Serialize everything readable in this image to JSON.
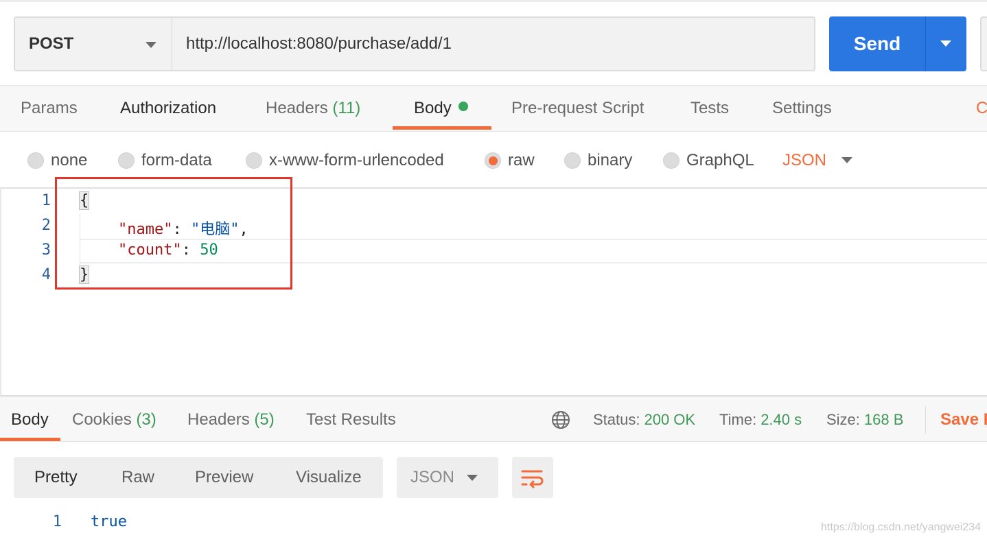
{
  "request": {
    "method": "POST",
    "url": "http://localhost:8080/purchase/add/1",
    "send_label": "Send"
  },
  "request_tabs": [
    {
      "label": "Params",
      "count": ""
    },
    {
      "label": "Authorization",
      "count": ""
    },
    {
      "label": "Headers",
      "count": "(11)"
    },
    {
      "label": "Body",
      "count": ""
    },
    {
      "label": "Pre-request Script",
      "count": ""
    },
    {
      "label": "Tests",
      "count": ""
    },
    {
      "label": "Settings",
      "count": ""
    }
  ],
  "active_request_tab": "Body",
  "cut_off_right_label": "C",
  "body_types": [
    {
      "label": "none",
      "selected": false
    },
    {
      "label": "form-data",
      "selected": false
    },
    {
      "label": "x-www-form-urlencoded",
      "selected": false
    },
    {
      "label": "raw",
      "selected": true
    },
    {
      "label": "binary",
      "selected": false
    },
    {
      "label": "GraphQL",
      "selected": false
    }
  ],
  "body_format": "JSON",
  "editor": {
    "line_numbers": [
      "1",
      "2",
      "3",
      "4"
    ],
    "open_brace": "{",
    "close_brace": "}",
    "key_name": "\"name\"",
    "val_name": "\"电脑\"",
    "key_count": "\"count\"",
    "val_count": "50"
  },
  "response_tabs": [
    {
      "label": "Body",
      "count": ""
    },
    {
      "label": "Cookies",
      "count": "(3)"
    },
    {
      "label": "Headers",
      "count": "(5)"
    },
    {
      "label": "Test Results",
      "count": ""
    }
  ],
  "response_meta": {
    "status_label": "Status:",
    "status_value": "200 OK",
    "time_label": "Time:",
    "time_value": "2.40 s",
    "size_label": "Size:",
    "size_value": "168 B",
    "save_label": "Save R"
  },
  "view_modes": [
    "Pretty",
    "Raw",
    "Preview",
    "Visualize"
  ],
  "active_view_mode": "Pretty",
  "response_format": "JSON",
  "response_body": {
    "line_number": "1",
    "value": "true"
  },
  "watermark": "https://blog.csdn.net/yangwei234",
  "colors": {
    "accent_orange": "#f26b3a",
    "send_blue": "#2a77e2",
    "status_green": "#3f9a5a",
    "annotation_red": "#e0362c"
  }
}
